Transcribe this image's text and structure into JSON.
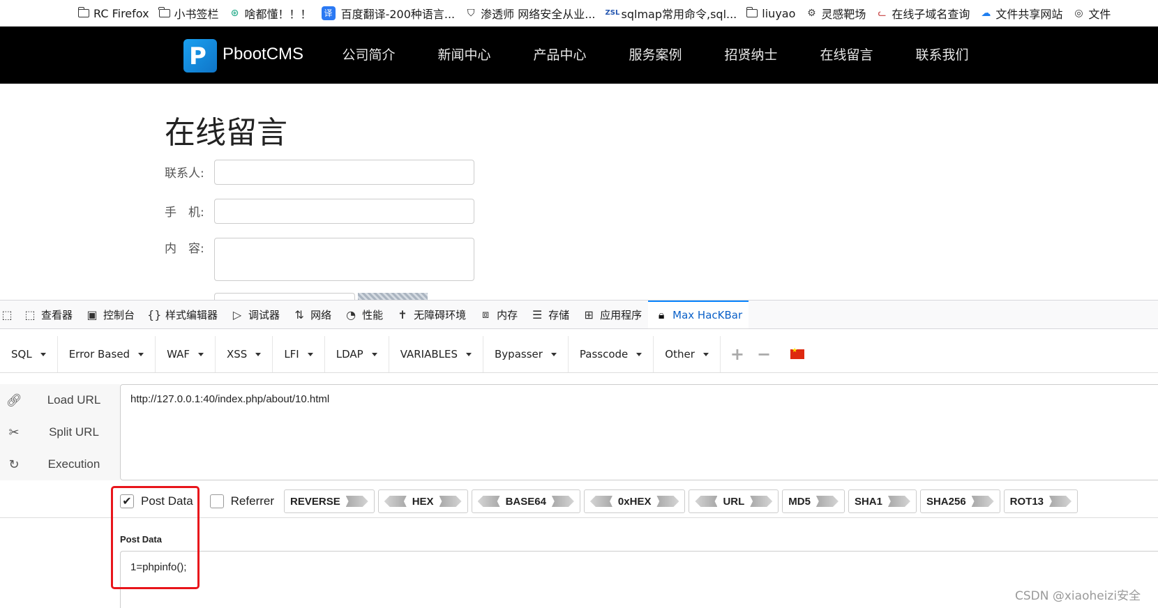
{
  "bookmarks": [
    {
      "label": "RC Firefox",
      "icon": "folder-icon"
    },
    {
      "label": "小书签栏",
      "icon": "folder-icon"
    },
    {
      "label": "啥都懂！！！",
      "icon": "openai-icon"
    },
    {
      "label": "百度翻译-200种语言...",
      "icon": "translate-icon"
    },
    {
      "label": "渗透师 网络安全从业...",
      "icon": "shield-icon"
    },
    {
      "label": "sqlmap常用命令,sql...",
      "icon": "zsl-icon"
    },
    {
      "label": "liuyao",
      "icon": "folder-icon"
    },
    {
      "label": "灵感靶场",
      "icon": "bug-icon"
    },
    {
      "label": "在线子域名查询",
      "icon": "cat-icon"
    },
    {
      "label": "文件共享网站",
      "icon": "cloud-icon"
    },
    {
      "label": "文件",
      "icon": "globe-icon"
    }
  ],
  "site": {
    "logo_text": "PbootCMS",
    "nav": [
      "公司简介",
      "新闻中心",
      "产品中心",
      "服务案例",
      "招贤纳士",
      "在线留言",
      "联系我们"
    ]
  },
  "form": {
    "title": "在线留言",
    "contact_label": "联系人:",
    "phone_label": "手　机:",
    "content_label": "内　容:",
    "contact_value": "",
    "phone_value": "",
    "content_value": ""
  },
  "devtools": {
    "tabs": [
      "查看器",
      "控制台",
      "样式编辑器",
      "调试器",
      "网络",
      "性能",
      "无障碍环境",
      "内存",
      "存储",
      "应用程序",
      "Max HacKBar"
    ],
    "active_tab": "Max HacKBar"
  },
  "hackbar": {
    "menus": [
      "SQL",
      "Error Based",
      "WAF",
      "XSS",
      "LFI",
      "LDAP",
      "VARIABLES",
      "Bypasser",
      "Passcode",
      "Other"
    ],
    "actions": [
      "Load URL",
      "Split URL",
      "Execution"
    ],
    "url": "http://127.0.0.1:40/index.php/about/10.html",
    "post_data_checked": true,
    "post_data_option": "Post Data",
    "referrer_checked": false,
    "referrer_option": "Referrer",
    "encoders": [
      "REVERSE",
      "HEX",
      "BASE64",
      "0xHEX",
      "URL",
      "MD5",
      "SHA1",
      "SHA256",
      "ROT13"
    ],
    "post_data_label": "Post Data",
    "post_data_value": "1=phpinfo();",
    "highlight_color": "#e8151b"
  },
  "watermark": "CSDN @xiaoheizi安全"
}
